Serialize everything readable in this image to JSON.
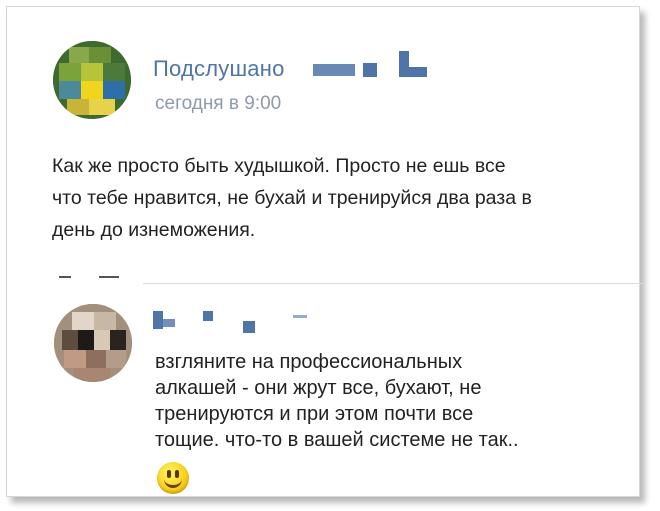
{
  "post": {
    "author": "Подслушано",
    "time": "сегодня в 9:00",
    "lines": [
      "Как же просто быть худышкой. Просто не ешь все",
      "что тебе нравится, не бухай и тренируйся два раза в",
      "день до изнеможения."
    ]
  },
  "comment": {
    "lines": [
      "взгляните на профессиональных",
      "алкашей - они жрут все, бухают, не",
      "тренируются и при этом почти все",
      "тощие. что-то в вашей системе не так.."
    ],
    "emoji": "smiley-face-icon"
  },
  "colors": {
    "link_blue": "#4f74a8",
    "timestamp_gray": "#8f9aa8",
    "text": "#222222",
    "divider": "#d9dde3"
  }
}
